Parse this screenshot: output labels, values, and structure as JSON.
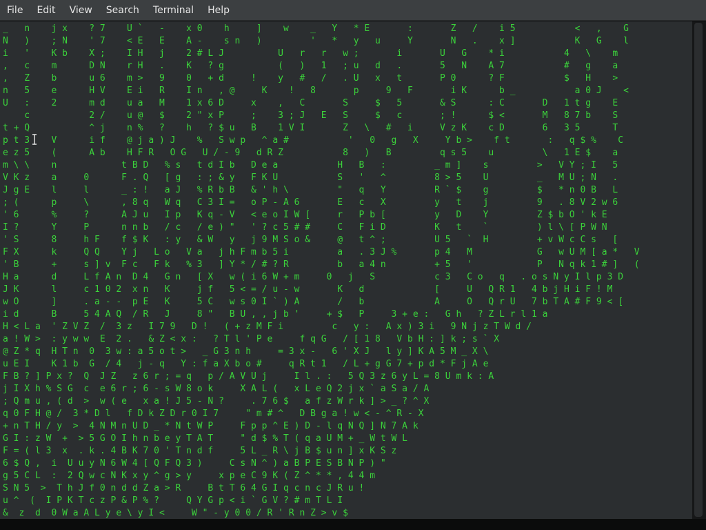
{
  "menu": [
    "File",
    "Edit",
    "View",
    "Search",
    "Terminal",
    "Help"
  ],
  "terminal": {
    "lines": [
      "_   n    j x    ? 7    U `   -    x 0    h     ]    w    _   Y   * E       :       Z   /    i 5           <   ,    G",
      "N   )    ; N    ' 7    < E   E    A -    s n   )         '   *   y   u     Y       N   .    x ]           K   G    l",
      "i   '    K b    X ;    I H   j    2 # L J          U   r   r   w ;       i       U   G    * i           4   \\    m",
      ",   c    m      D N    r H   .    K   ? g          (   )   1   ; u   d   .       5   N    A 7           #   g    a",
      ",   Z    b      u 6    m >   9    0   + d     !    y   #   /   . U   x   t       P 0      ? F           $   H    >",
      "n   5    e      H V    E i   R    I n   , @     K    !   8       p     9   F       i K      b _           a 0 J    <",
      "U   :    2      m d    u a   M    1 x 6 D     x    ,   C       S     $   5       & S      : C       D   1 t g    E",
      "    c           2 /    u @   $    2 \" x P     ;    3 ; J   E   S     $   c       ; !      $ <       M   8 7 b    S",
      "t + Q           ^ j    n %   ?    h   ? $ u   B    1 V I       Z   \\   #   i     V z K    c D       6   3 5      T",
      "p t 3    V      i f    @ j a ) J    %   S w p   ^ a #           '   0   g   X     Y b >    f t       :   q $ %    C",
      "e z 5    (      A b    H F R   O G   U / - 9   d R Z           8   )   B         q s 5    u         \\   1 E $    a",
      "m \\ \\    n            t B D   % s   t d I b   D e a           H   B   :         _ m ]    s         >   V Y ; I   5",
      "V K z    a     0      F . Q   [ g   : ; & y   F K U           S   '   ^         8 > 5    U         _   M U ; N   .",
      "J g E    l     l      _ : !   a J   % R b B   & ' h \\         \"   q   Y         R ` $    g         $   * n 0 B   L",
      "; (      p     \\      , 8 q   W q   C 3 I =   o P - A 6       E   c   X         y   t    j         9   . 8 V 2 w 6",
      "' 6      %     ?      A J u   I p   K q - V   < e o I W [     r   P b [         y   D    Y         Z $ b O ' k E",
      "I ?      Y     P      n n b   / c   / e ) \"   ' ? c 5 # #     C   F i D         K   t    `         ) l \\ [ P W N",
      "' S      8     h F    f $ K   : y   & W   y   j 9 M S o &     @   t ^ ;         U 5   `  H         + v W c C s   [",
      "F X      k     Q Q    Y j   L o   V a   j h F m b 5 i         a   . 3 J %       p 4   M            G   w U M [ a *   V",
      "' B      +     s ] v  F c   F k   % 3   ] Y * / # ? R         b   a 4 n         + 5   '            P   N q k 1 # ]   (",
      "H a      d     L f A n  D 4   G n   [ X   w ( i 6 W + m     0   j   S           c 3   C o   q   . o s N y I l p 3 D",
      "J K      l     c 1 0 2  x n   K     j f   5 < = / u - w       K   d             [     U   Q R 1   4 b j H i F ! M",
      "w O      ]     . a - -  p E   K     5 C   w s 0 I ` ) A       /   b             A     O   Q r U   7 b T A # F 9 < [",
      "i d      B     5 4 A Q  / R   J     8 \"   B U , , j b '     + $   P     3 + e :   G h   ? Z L r l 1 a",
      "H < L a  ' Z V Z  /  3 z   I 7 9   D !   ( + z M F i         c   y :   A x ) 3 i   9 N j z T W d /",
      "a ! W >  : y w w  E  2 .   & Z < x :   ? T l ' P e     f q G   / [ 1 8   V b H : ] k ; s ` X",
      "@ Z * q  H T n  0  3 w : a 5 o t >   _ G 3 n h     = 3 x -   6 ' X J   l y ] K A 5 M _ X \\",
      "u E I    K 1 b  G  / 4   j - q   Y : f a X b o #     q R t 1   / L + g G 7 + p d * F j A e",
      "F B ? ] P x ?  Q  J Z   z 6 r ; = q   p / A V U j     I l . :   5 Q 3 z 6 y L = 8 U m k : A",
      "j I X h % S G  c  e 6 r ; 6 - s W 8 o k     X A L (   x L e Q 2 j x ` a S a / A",
      "; Q m u , ( d  >  w ( e   x a ! J 5 - N ?     . 7 6 $   a f z W r k ] > _ ? ^ X",
      "q 0 F H @ /  3 * D l   f D k Z D r 0 I 7     \" m # ^   D B g a ! w < - ^ R - X",
      "+ n T H / y  >  4 N M n U D _ * N t W P     F p p ^ E ) D - l q N Q ] N 7 A k",
      "G I : z W  +  > 5 G O I h n b e y T A T     \" d $ % T ( q a U M + _ W t W L",
      "F = ( l 3  x  . k . 4 B K 7 0 ' T n d f     5 L _ R \\ j B $ u n ] x K S z",
      "6 $ Q ,  i  U u y N 6 W 4 [ Q F Q 3 )     C s N ^ ) a B P E S B N P ) \"",
      "g 5 C L  :  2 Q w c N K x y ^ g > y     x p e C 9 K ( Z ^ * * , 4 4 m",
      "S N 5  >  T h J f 0 n d d Z a > R     B t T 6 4 G I q c n c J R u !",
      "u ^  (  I P K T c z P & P % ?     Q Y G p < i ` G V ? # m T L I",
      "&  z  d  0 W a A L y e \\ y I <     W \" - y 0 0 / R ' R n Z > v $"
    ]
  },
  "colors": {
    "terminal_bg": "#2b2e30",
    "glyph_green": "#3bd23b",
    "glyph_white": "#f2f2f2",
    "menubar_bg": "#3c3f41"
  },
  "icons": {
    "cursor": "text-cursor-icon"
  }
}
